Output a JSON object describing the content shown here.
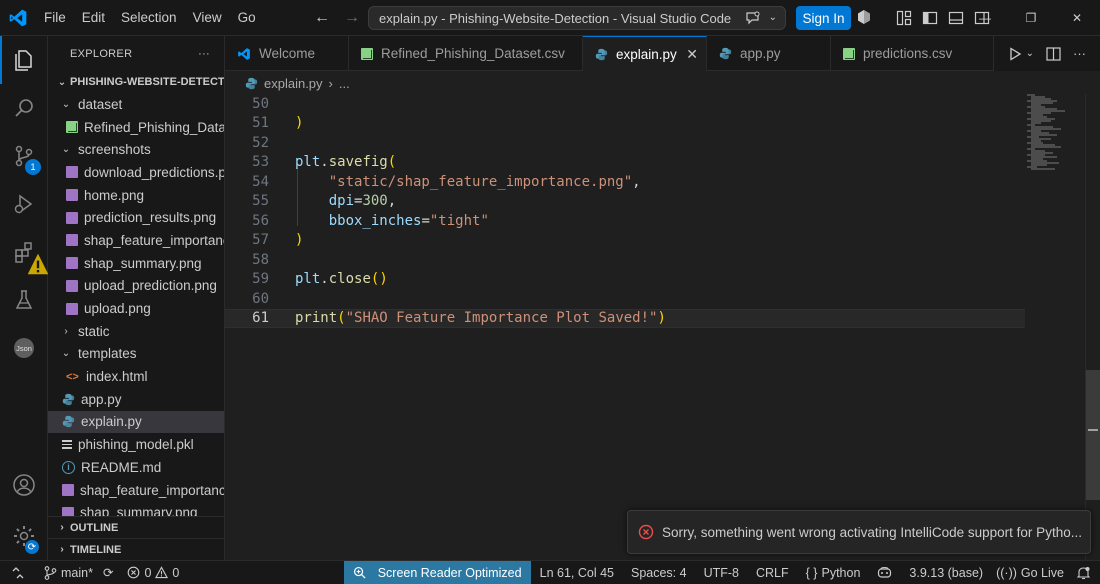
{
  "titlebar": {
    "menu": [
      "File",
      "Edit",
      "Selection",
      "View",
      "Go"
    ],
    "search_text": "explain.py - Phishing-Website-Detection - Visual Studio Code",
    "signin_label": "Sign In",
    "window_controls": [
      "minimize-icon",
      "restore-icon",
      "close-icon"
    ]
  },
  "activitybar": {
    "items": [
      "files-icon",
      "search-icon",
      "source-control-icon",
      "run-debug-icon",
      "extensions-icon",
      "testing-icon",
      "json-icon"
    ],
    "source_control_badge": "1",
    "bottom": [
      "account-icon",
      "manage-gear-icon"
    ]
  },
  "sidebar": {
    "title": "EXPLORER",
    "more": "···",
    "project": "PHISHING-WEBSITE-DETECTION",
    "tree": [
      {
        "label": "dataset",
        "type": "folder",
        "open": true,
        "depth": 1
      },
      {
        "label": "Refined_Phishing_Dataset.csv",
        "type": "csv",
        "depth": 2
      },
      {
        "label": "screenshots",
        "type": "folder",
        "open": true,
        "depth": 1
      },
      {
        "label": "download_predictions.png",
        "type": "png",
        "depth": 2
      },
      {
        "label": "home.png",
        "type": "png",
        "depth": 2
      },
      {
        "label": "prediction_results.png",
        "type": "png",
        "depth": 2
      },
      {
        "label": "shap_feature_importance.png",
        "type": "png",
        "depth": 2
      },
      {
        "label": "shap_summary.png",
        "type": "png",
        "depth": 2
      },
      {
        "label": "upload_prediction.png",
        "type": "png",
        "depth": 2
      },
      {
        "label": "upload.png",
        "type": "png",
        "depth": 2
      },
      {
        "label": "static",
        "type": "folder",
        "open": false,
        "depth": 1
      },
      {
        "label": "templates",
        "type": "folder",
        "open": true,
        "depth": 1
      },
      {
        "label": "index.html",
        "type": "html",
        "depth": 2
      },
      {
        "label": "app.py",
        "type": "py",
        "depth": 1
      },
      {
        "label": "explain.py",
        "type": "py",
        "depth": 1,
        "selected": true
      },
      {
        "label": "phishing_model.pkl",
        "type": "pkl",
        "depth": 1
      },
      {
        "label": "README.md",
        "type": "info",
        "depth": 1
      },
      {
        "label": "shap_feature_importance.png",
        "type": "png",
        "depth": 1
      },
      {
        "label": "shap_summary.png",
        "type": "png",
        "depth": 1
      }
    ],
    "outline_label": "OUTLINE",
    "timeline_label": "TIMELINE"
  },
  "tabs": [
    {
      "label": "Welcome",
      "icon": "vscode-icon"
    },
    {
      "label": "Refined_Phishing_Dataset.csv",
      "icon": "csv"
    },
    {
      "label": "explain.py",
      "icon": "py",
      "active": true
    },
    {
      "label": "app.py",
      "icon": "py"
    },
    {
      "label": "predictions.csv",
      "icon": "csv"
    }
  ],
  "breadcrumb": {
    "file": "explain.py",
    "separator": "›",
    "more": "..."
  },
  "editor": {
    "lines": [
      {
        "n": "50",
        "tokens": []
      },
      {
        "n": "51",
        "tokens": [
          [
            "br1",
            ")"
          ]
        ]
      },
      {
        "n": "52",
        "tokens": []
      },
      {
        "n": "53",
        "tokens": [
          [
            "var",
            "plt"
          ],
          [
            "plain",
            "."
          ],
          [
            "fn",
            "savefig"
          ],
          [
            "br1",
            "("
          ]
        ]
      },
      {
        "n": "54",
        "tokens": [
          [
            "plain",
            "    "
          ],
          [
            "str",
            "\"static/shap_feature_importance.png\""
          ],
          [
            "plain",
            ","
          ]
        ]
      },
      {
        "n": "55",
        "tokens": [
          [
            "plain",
            "    "
          ],
          [
            "var",
            "dpi"
          ],
          [
            "plain",
            "="
          ],
          [
            "num",
            "300"
          ],
          [
            "plain",
            ","
          ]
        ]
      },
      {
        "n": "56",
        "tokens": [
          [
            "plain",
            "    "
          ],
          [
            "var",
            "bbox_inches"
          ],
          [
            "plain",
            "="
          ],
          [
            "str",
            "\"tight\""
          ]
        ]
      },
      {
        "n": "57",
        "tokens": [
          [
            "br1",
            ")"
          ]
        ]
      },
      {
        "n": "58",
        "tokens": []
      },
      {
        "n": "59",
        "tokens": [
          [
            "var",
            "plt"
          ],
          [
            "plain",
            "."
          ],
          [
            "fn",
            "close"
          ],
          [
            "br1",
            "()"
          ]
        ]
      },
      {
        "n": "60",
        "tokens": []
      },
      {
        "n": "61",
        "tokens": [
          [
            "fn",
            "print"
          ],
          [
            "br1",
            "("
          ],
          [
            "str",
            "\"SHAO Feature Importance Plot Saved!\""
          ],
          [
            "br1",
            ")"
          ]
        ],
        "current": true
      }
    ]
  },
  "notification": {
    "text": "Sorry, something went wrong activating IntelliCode support for Pytho..."
  },
  "statusbar": {
    "branch": "main*",
    "errors": "0",
    "warnings": "0",
    "screen_reader": "Screen Reader Optimized",
    "position": "Ln 61, Col 45",
    "spaces": "Spaces: 4",
    "encoding": "UTF-8",
    "eol": "CRLF",
    "language": "Python",
    "interpreter": "3.9.13 (base)",
    "golive": "Go Live"
  },
  "colors": {
    "accent": "#0078d4",
    "background": "#1f1f1f",
    "sidebar": "#181818",
    "error": "#f14c4c",
    "warning": "#cca700"
  }
}
